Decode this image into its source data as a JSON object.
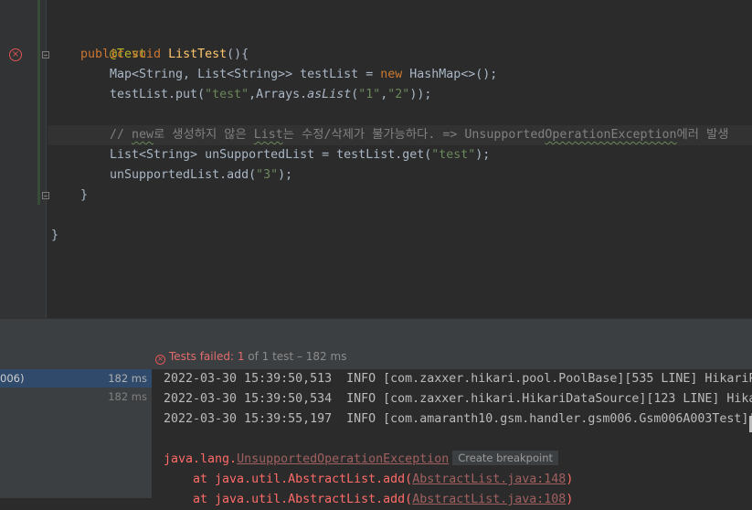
{
  "editor": {
    "lines": {
      "annotation": "@Test",
      "method_mod": "public void ",
      "method_name": "ListTest",
      "method_rest": "(){",
      "l3_a": "Map<String, List<String>> testList = ",
      "l3_kw": "new",
      "l3_b": " HashMap<>();",
      "l4_a": "testList.put(",
      "l4_s1": "\"test\"",
      "l4_b": ",Arrays.",
      "l4_it": "asList",
      "l4_c": "(",
      "l4_s2": "\"1\"",
      "l4_d": ",",
      "l4_s3": "\"2\"",
      "l4_e": "));",
      "comment_a": "// ",
      "comment_w1": "new",
      "comment_b": "로 생성하지 않은 ",
      "comment_w2": "List",
      "comment_c": "는 수정/삭제가 불가능하다. => Unsupported",
      "comment_w3": "OperationException",
      "comment_d": "에러 발생",
      "l6_a": "List<String> unSupportedList = testList.get(",
      "l6_s": "\"test\"",
      "l6_b": ");",
      "l7_a": "unSupportedList.add(",
      "l7_s": "\"3\"",
      "l7_b": ");",
      "close_method": "}",
      "close_class": "}"
    },
    "error_icon_glyph": "×"
  },
  "status": {
    "prefix": "Tests failed: ",
    "failed": "1",
    "middle": " of 1 test",
    "suffix": " – 182 ms"
  },
  "tree": [
    {
      "label": "006)",
      "time": "182 ms",
      "selected": true
    },
    {
      "label": "",
      "time": "182 ms",
      "selected": false
    }
  ],
  "console": {
    "log1": "2022-03-30 15:39:50,513  INFO [com.zaxxer.hikari.pool.PoolBase][535 LINE] HikariP",
    "log2": "2022-03-30 15:39:50,534  INFO [com.zaxxer.hikari.HikariDataSource][123 LINE] Hika",
    "log3": "2022-03-30 15:39:55,197  INFO [com.amaranth10.gsm.handler.gsm006.Gsm006A003Test][",
    "exc_prefix": "java.lang.",
    "exc_link": "UnsupportedOperationException",
    "breakpoint_hint": "Create breakpoint",
    "st1_a": "    at java.util.AbstractList.add(",
    "st1_link": "AbstractList.java:148",
    "st1_b": ")",
    "st2_a": "    at java.util.AbstractList.add(",
    "st2_link": "AbstractList.java:108",
    "st2_b": ")"
  },
  "colors": {
    "editor_bg": "#2b2b2b",
    "keyword": "#cc7832",
    "string": "#6a8759",
    "method": "#ffc66d",
    "annotation": "#bbb529",
    "error": "#ff6b68"
  }
}
